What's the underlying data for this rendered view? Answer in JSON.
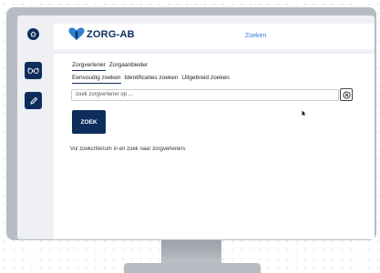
{
  "header": {
    "brand": "ZORG-AB",
    "title": "Zoeken"
  },
  "tabs_primary": [
    {
      "label": "Zorgverlener",
      "active": true
    },
    {
      "label": "Zorgaanbieder",
      "active": false
    }
  ],
  "tabs_secondary": [
    {
      "label": "Eenvoudig zoeken",
      "active": true
    },
    {
      "label": "Identificaties zoeken",
      "active": false
    },
    {
      "label": "Uitgebreid zoeken",
      "active": false
    }
  ],
  "search": {
    "placeholder": "zoek zorgverlener op ...",
    "button_label": "ZOEK"
  },
  "hint_text": "Vul zoekcriterium in en zoek naar zorgverleners",
  "icons": {
    "home": "home-icon",
    "glasses": "glasses-icon",
    "pencil": "pencil-icon",
    "clear": "clear-icon",
    "cursor": "cursor-icon"
  },
  "colors": {
    "primary": "#0d2d5c",
    "accent": "#3a7bd5",
    "logo_heart": "#2f7fd1"
  }
}
